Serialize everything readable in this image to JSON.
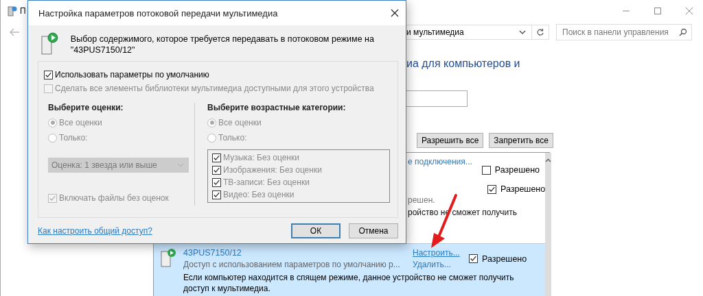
{
  "window": {
    "title": "П"
  },
  "address_bar": {
    "path": "и мультимедиа"
  },
  "search": {
    "placeholder": "Поиск в панели управления"
  },
  "heading": "иа для компьютеров и",
  "buttons": [
    "Разрешить все",
    "Запретить все"
  ],
  "devices": [
    {
      "link": "е подключения...",
      "allowed_label": "Разрешено",
      "allowed": false,
      "selected": false
    },
    {
      "allowed_label": "Разрешено",
      "allowed": true,
      "status": "решен.",
      "note": "ройство не сможет получить",
      "selected": false
    },
    {
      "name": "43PUS7150/12",
      "status": "Доступ с использованием параметров по умолчанию р...",
      "customize_link": "Настроить...",
      "remove_link": "Удалить...",
      "allowed_label": "Разрешено",
      "allowed": true,
      "note": "Если компьютер находится в спящем режиме, данное устройство не сможет получить доступ к мультимедиа.",
      "selected": true
    }
  ],
  "dialog": {
    "title": "Настройка параметров потоковой передачи мультимедиа",
    "header": "Выбор содержимого, которое требуется передавать в потоковом режиме на \"43PUS7150/12\"",
    "use_defaults": {
      "label": "Использовать параметры по умолчанию",
      "checked": true
    },
    "make_all_available": {
      "label": "Сделать все элементы библиотеки мультимедиа доступными для этого устройства",
      "checked": false,
      "disabled": true
    },
    "ratings": {
      "title": "Выберите оценки:",
      "options": [
        {
          "label": "Все оценки",
          "selected": true
        },
        {
          "label": "Только:",
          "selected": false
        }
      ],
      "dropdown": "Оценка: 1 звезда или выше",
      "include_unrated": {
        "label": "Включать файлы без оценок",
        "checked": true
      },
      "disabled": true
    },
    "age": {
      "title": "Выберите возрастные категории:",
      "options": [
        {
          "label": "Все оценки",
          "selected": true
        },
        {
          "label": "Только:",
          "selected": false
        }
      ],
      "items": [
        {
          "label": "Музыка: Без оценки",
          "checked": true
        },
        {
          "label": "Изображения: Без оценки",
          "checked": true
        },
        {
          "label": "ТВ-записи: Без оценки",
          "checked": true
        },
        {
          "label": "Видео: Без оценки",
          "checked": true
        }
      ],
      "disabled": true
    },
    "help_link": "Как настроить общий доступ?",
    "ok": "ОК",
    "cancel": "Отмена"
  }
}
